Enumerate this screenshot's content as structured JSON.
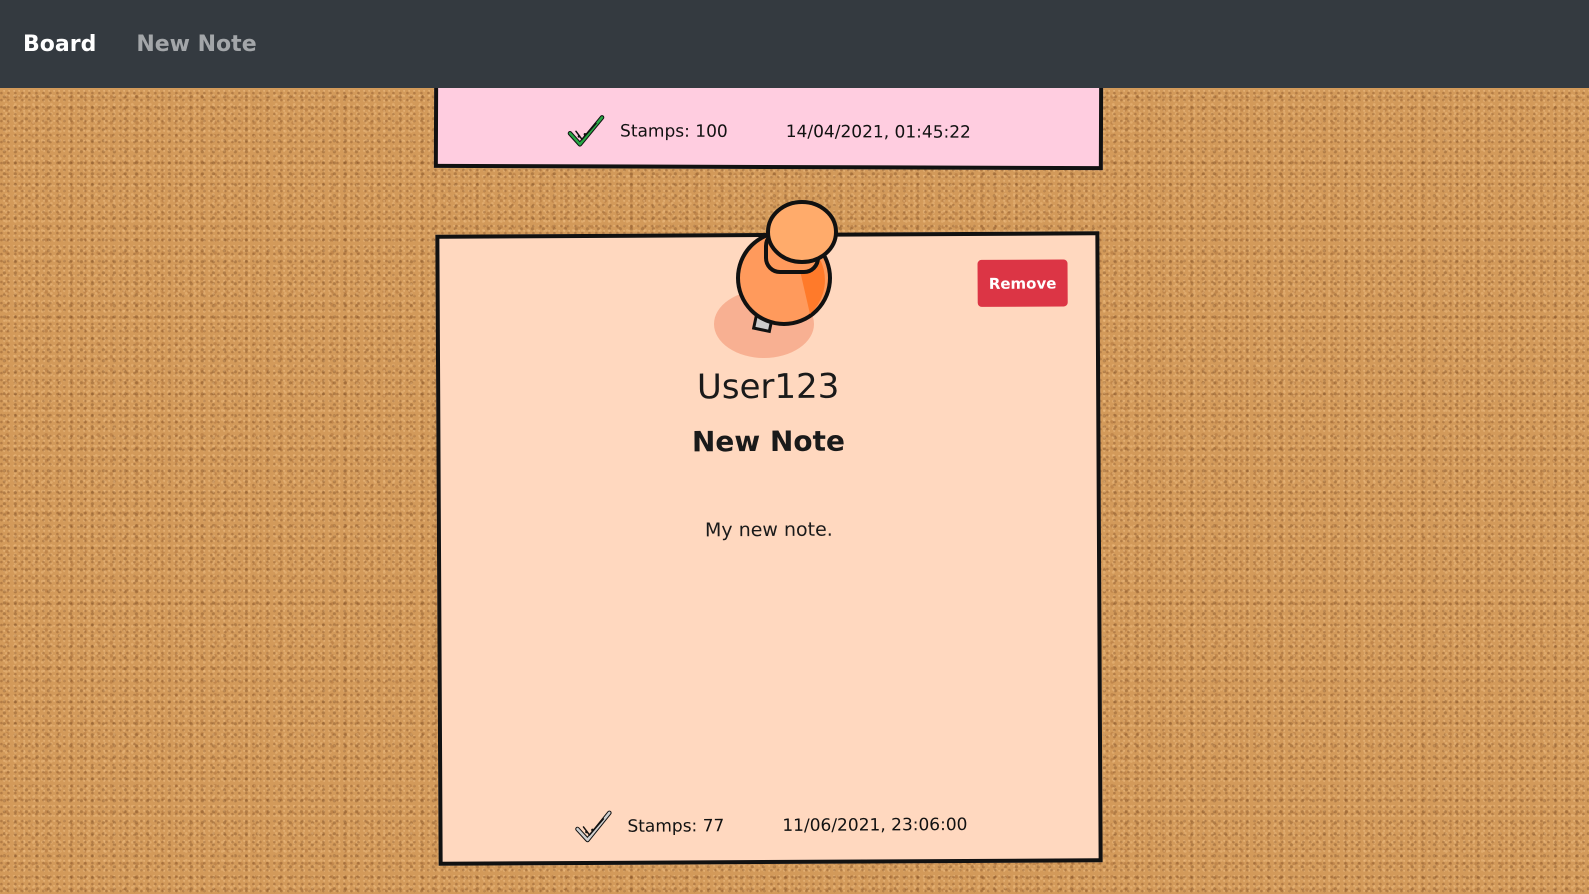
{
  "navbar": {
    "brand": "Board",
    "links": [
      {
        "label": "New Note"
      }
    ]
  },
  "notes": [
    {
      "color": "#ffcde0",
      "stamp_icon": "green-check-stamp-icon",
      "stamp_label": "Stamps: 100",
      "timestamp": "14/04/2021, 01:45:22"
    },
    {
      "color": "#ffd8bf",
      "pin_icon": "orange-pushpin-icon",
      "remove_label": "Remove",
      "author": "User123",
      "title": "New Note",
      "body": "My new note.",
      "stamp_icon": "gray-check-stamp-icon",
      "stamp_label": "Stamps: 77",
      "timestamp": "11/06/2021, 23:06:00"
    }
  ],
  "colors": {
    "navbar_bg": "#343a40",
    "remove_button": "#dc3545",
    "cork": "#d39a5a",
    "stamp_active": "#28a745",
    "stamp_inactive": "#8a8a8a"
  }
}
